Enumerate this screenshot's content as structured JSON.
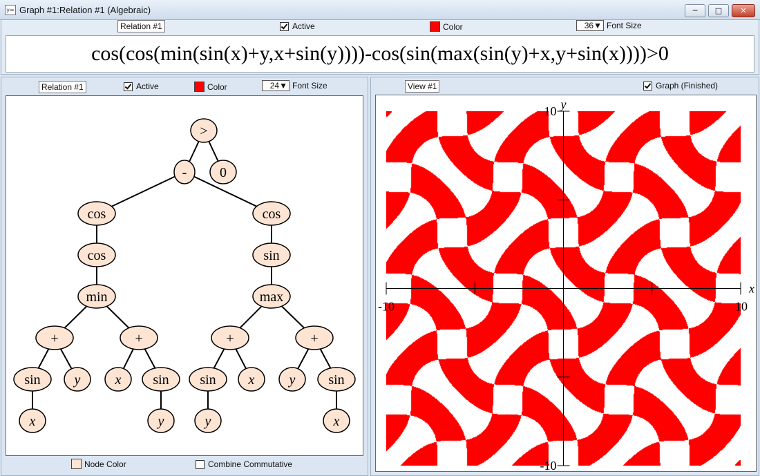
{
  "window": {
    "title": "Graph #1:Relation #1 (Algebraic)",
    "icon": "y=",
    "controls": [
      "minimize-icon",
      "maximize-icon",
      "close-icon"
    ]
  },
  "top_toolbar": {
    "relation_label": "Relation #1",
    "active_label": "Active",
    "active_checked": true,
    "color_label": "Color",
    "color": "#ff0000",
    "font_size": "36",
    "font_size_label": "Font Size"
  },
  "formula": {
    "text": "cos(cos(min(sin(x)+y,x+sin(y))))-cos(sin(max(sin(y)+x,y+sin(x))))>0"
  },
  "tree_panel": {
    "relation_label": "Relation #1",
    "active_label": "Active",
    "active_checked": true,
    "color_label": "Color",
    "color": "#ff0000",
    "font_size": "24",
    "font_size_label": "Font Size",
    "node_color_label": "Node Color",
    "node_color": "#fde4d3",
    "combine_label": "Combine Commutative",
    "combine_checked": false,
    "nodes": [
      {
        "id": "gt",
        "label": ">",
        "italic": false
      },
      {
        "id": "minus",
        "label": "-",
        "italic": false
      },
      {
        "id": "zero",
        "label": "0",
        "italic": false
      },
      {
        "id": "cosL",
        "label": "cos",
        "italic": false
      },
      {
        "id": "cosR",
        "label": "cos",
        "italic": false
      },
      {
        "id": "cos2",
        "label": "cos",
        "italic": false
      },
      {
        "id": "sinR",
        "label": "sin",
        "italic": false
      },
      {
        "id": "min",
        "label": "min",
        "italic": false
      },
      {
        "id": "max",
        "label": "max",
        "italic": false
      },
      {
        "id": "p1",
        "label": "+",
        "italic": false
      },
      {
        "id": "p2",
        "label": "+",
        "italic": false
      },
      {
        "id": "p3",
        "label": "+",
        "italic": false
      },
      {
        "id": "p4",
        "label": "+",
        "italic": false
      },
      {
        "id": "s1",
        "label": "sin",
        "italic": false
      },
      {
        "id": "y1",
        "label": "y",
        "italic": true
      },
      {
        "id": "x1",
        "label": "x",
        "italic": true
      },
      {
        "id": "s2",
        "label": "sin",
        "italic": false
      },
      {
        "id": "s3",
        "label": "sin",
        "italic": false
      },
      {
        "id": "x2",
        "label": "x",
        "italic": true
      },
      {
        "id": "y2",
        "label": "y",
        "italic": true
      },
      {
        "id": "s4",
        "label": "sin",
        "italic": false
      },
      {
        "id": "xa",
        "label": "x",
        "italic": true
      },
      {
        "id": "yb",
        "label": "y",
        "italic": true
      },
      {
        "id": "yc",
        "label": "y",
        "italic": true
      },
      {
        "id": "xd",
        "label": "x",
        "italic": true
      }
    ],
    "edges": [
      [
        "gt",
        "minus"
      ],
      [
        "gt",
        "zero"
      ],
      [
        "minus",
        "cosL"
      ],
      [
        "minus",
        "cosR"
      ],
      [
        "cosL",
        "cos2"
      ],
      [
        "cosR",
        "sinR"
      ],
      [
        "cos2",
        "min"
      ],
      [
        "sinR",
        "max"
      ],
      [
        "min",
        "p1"
      ],
      [
        "min",
        "p2"
      ],
      [
        "max",
        "p3"
      ],
      [
        "max",
        "p4"
      ],
      [
        "p1",
        "s1"
      ],
      [
        "p1",
        "y1"
      ],
      [
        "p2",
        "x1"
      ],
      [
        "p2",
        "s2"
      ],
      [
        "p3",
        "s3"
      ],
      [
        "p3",
        "x2"
      ],
      [
        "p4",
        "y2"
      ],
      [
        "p4",
        "s4"
      ],
      [
        "s1",
        "xa"
      ],
      [
        "s2",
        "yb"
      ],
      [
        "s3",
        "yc"
      ],
      [
        "s4",
        "xd"
      ]
    ]
  },
  "graph_panel": {
    "view_label": "View #1",
    "graph_label": "Graph (Finished)",
    "graph_checked": true,
    "fill_color": "#ff0000",
    "x_axis_label": "x",
    "y_axis_label": "y",
    "x_min_label": "-10",
    "x_max_label": "10",
    "y_max_label": "10",
    "y_min_label": "-10",
    "x_range": [
      -10,
      10
    ],
    "y_range": [
      -10,
      10
    ],
    "tick_step": 5
  }
}
